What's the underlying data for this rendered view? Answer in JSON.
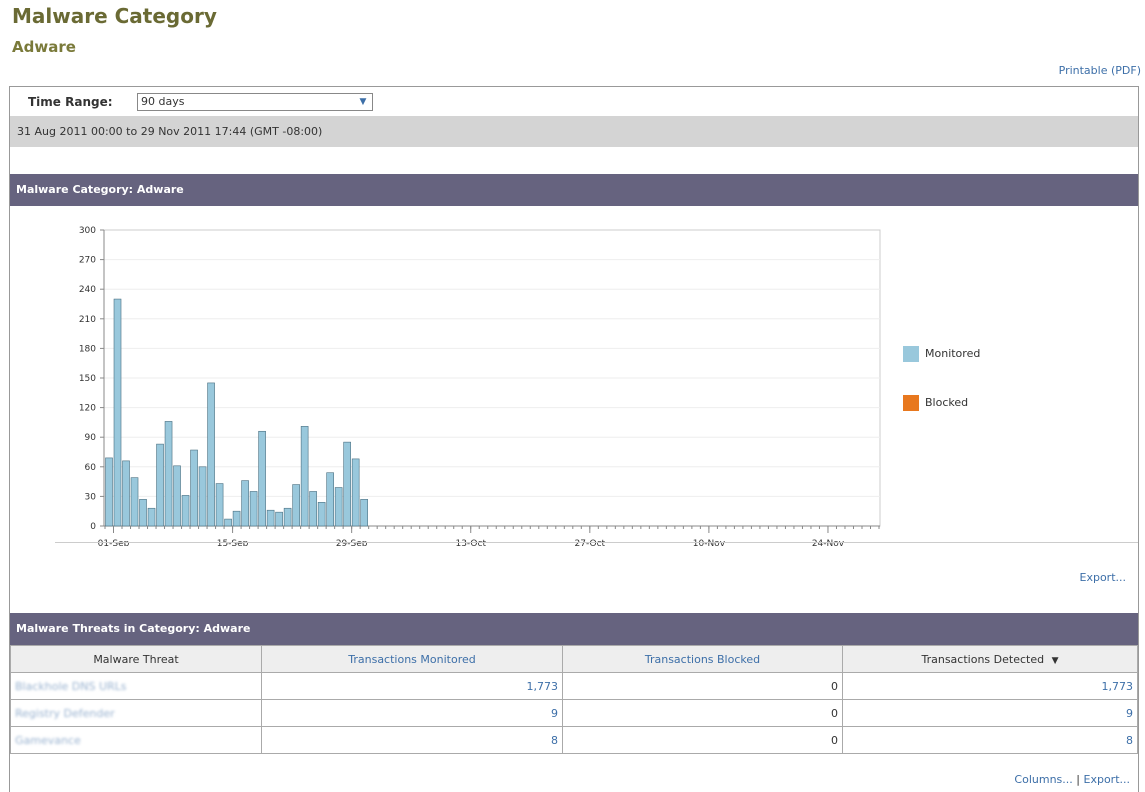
{
  "page": {
    "title": "Malware Category",
    "subtitle": "Adware",
    "printable_label": "Printable (PDF)"
  },
  "filter": {
    "time_range_label": "Time Range:",
    "time_range_value": "90 days",
    "date_range_text": "31 Aug 2011 00:00 to 29 Nov 2011 17:44 (GMT -08:00)"
  },
  "chart_section": {
    "header": "Malware Category: Adware",
    "export_label": "Export..."
  },
  "chart_data": {
    "type": "bar",
    "title": "",
    "xlabel": "",
    "ylabel": "",
    "ylim": [
      0,
      300
    ],
    "yticks": [
      0,
      30,
      60,
      90,
      120,
      150,
      180,
      210,
      240,
      270,
      300
    ],
    "xtick_labels": [
      "01-Sep",
      "15-Sep",
      "29-Sep",
      "13-Oct",
      "27-Oct",
      "10-Nov",
      "24-Nov"
    ],
    "xtick_day_index": [
      1,
      15,
      29,
      43,
      57,
      71,
      85
    ],
    "num_days": 91,
    "grid": true,
    "legend_position": "right",
    "series": [
      {
        "name": "Monitored",
        "color": "#99c8dc",
        "values": [
          69,
          230,
          66,
          49,
          27,
          18,
          83,
          106,
          61,
          31,
          77,
          60,
          145,
          43,
          7,
          15,
          46,
          35,
          96,
          16,
          14,
          18,
          42,
          101,
          35,
          24,
          54,
          39,
          85,
          68,
          27,
          0,
          0,
          0,
          0,
          0,
          0,
          0,
          0,
          0,
          0,
          0,
          0,
          0,
          0,
          0,
          0,
          0,
          0,
          0,
          0,
          0,
          0,
          0,
          0,
          0,
          0,
          0,
          0,
          0,
          0,
          0,
          0,
          0,
          0,
          0,
          0,
          0,
          0,
          0,
          0,
          0,
          0,
          0,
          0,
          0,
          0,
          0,
          0,
          0,
          0,
          0,
          0,
          0,
          0,
          0,
          0,
          0,
          0,
          0,
          0
        ]
      },
      {
        "name": "Blocked",
        "color": "#e8781e",
        "values": []
      }
    ]
  },
  "threats_section": {
    "header": "Malware Threats in Category: Adware",
    "columns": [
      "Malware Threat",
      "Transactions Monitored",
      "Transactions Blocked",
      "Transactions Detected"
    ],
    "sort_indicator": "▼",
    "rows": [
      {
        "name": "Blackhole DNS URLs",
        "monitored": "1,773",
        "blocked": "0",
        "detected": "1,773"
      },
      {
        "name": "Registry Defender",
        "monitored": "9",
        "blocked": "0",
        "detected": "9"
      },
      {
        "name": "Gamevance",
        "monitored": "8",
        "blocked": "0",
        "detected": "8"
      }
    ],
    "columns_link": "Columns...",
    "separator": "|",
    "export_label": "Export..."
  }
}
